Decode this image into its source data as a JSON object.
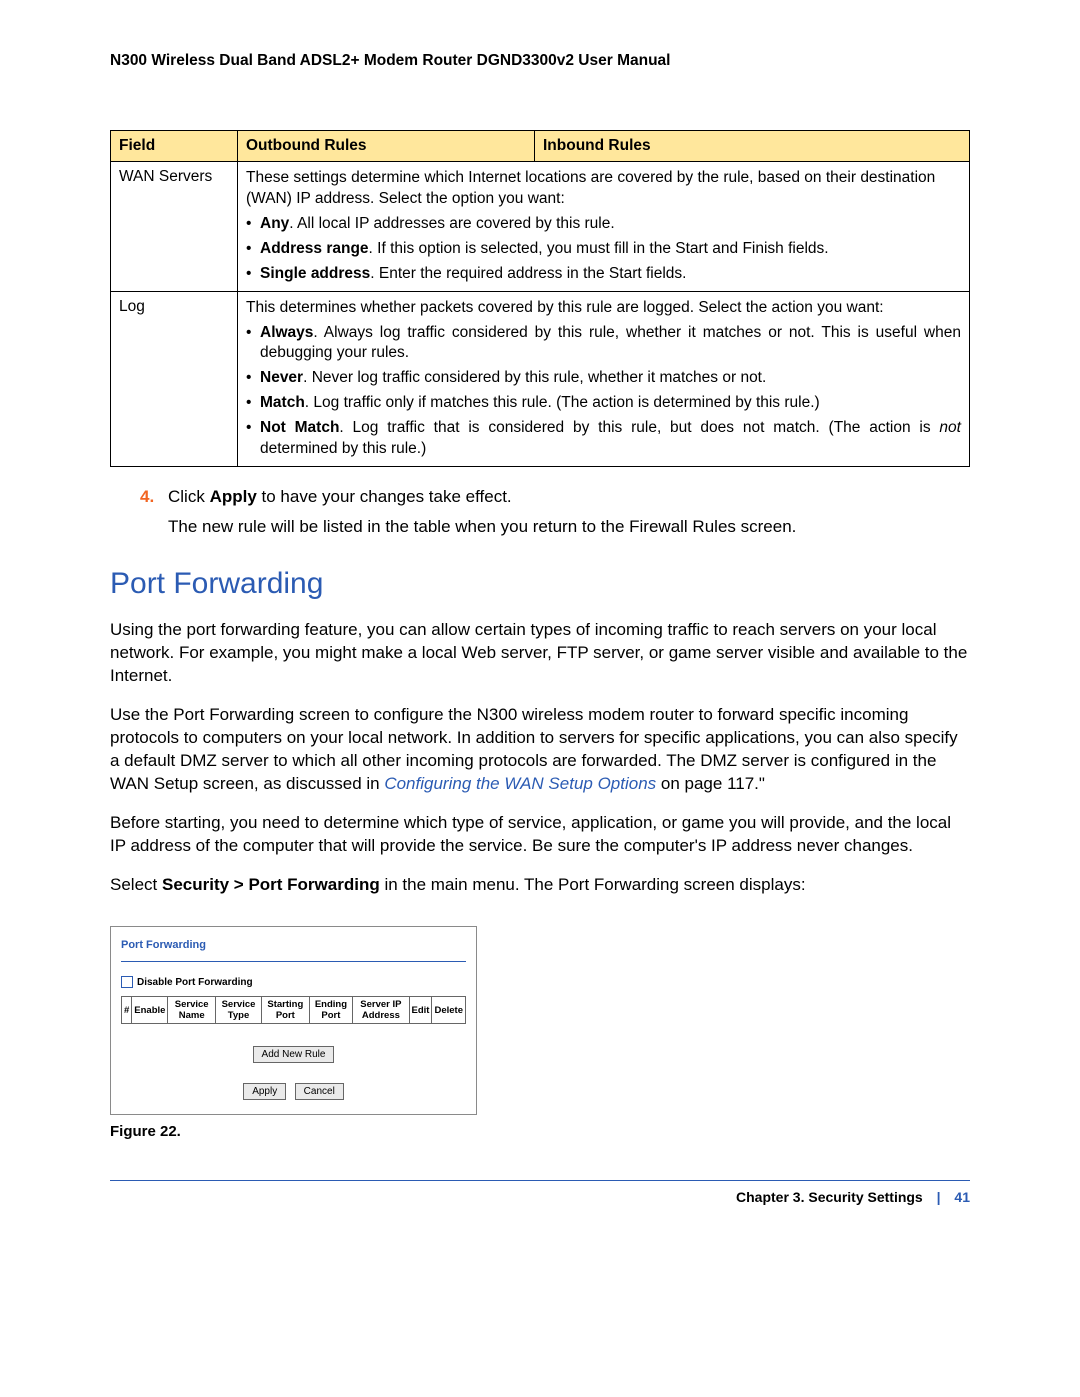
{
  "doc_title": "N300 Wireless Dual Band ADSL2+ Modem Router DGND3300v2 User Manual",
  "table": {
    "headers": {
      "field": "Field",
      "outbound": "Outbound Rules",
      "inbound": "Inbound Rules"
    },
    "rows": [
      {
        "field": "WAN Servers",
        "intro": "These settings determine which Internet locations are covered by the rule, based on their destination (WAN) IP address. Select the option you want:",
        "bullets": [
          {
            "b": "Any",
            "t": ". All local IP addresses are covered by this rule."
          },
          {
            "b": "Address range",
            "t": ". If this option is selected, you must fill in the Start and Finish fields."
          },
          {
            "b": "Single address",
            "t": ". Enter the required address in the Start fields."
          }
        ]
      },
      {
        "field": "Log",
        "intro": "This determines whether packets covered by this rule are logged. Select the action you want:",
        "bullets": [
          {
            "b": "Always",
            "t": ". Always log traffic considered by this rule, whether it matches or not. This is useful when debugging your rules."
          },
          {
            "b": "Never",
            "t": ". Never log traffic considered by this rule, whether it matches or not."
          },
          {
            "b": "Match",
            "t": ". Log traffic only if matches this rule. (The action is determined by this rule.)"
          },
          {
            "b": "Not Match",
            "t": ". Log traffic that is considered by this rule, but does not match. (The action is ",
            "i": "not",
            "t2": " determined by this rule.)"
          }
        ]
      }
    ]
  },
  "step": {
    "num": "4.",
    "text_pre": "Click ",
    "text_b": "Apply",
    "text_post": " to have your changes take effect.",
    "follow": "The new rule will be listed in the table when you return to the Firewall Rules screen."
  },
  "section_heading": "Port Forwarding",
  "para1": "Using the port forwarding feature, you can allow certain types of incoming traffic to reach servers on your local network. For example, you might make a local Web server, FTP server, or game server visible and available to the Internet.",
  "para2_pre": "Use the Port Forwarding screen to configure the N300 wireless modem router to forward specific incoming protocols to computers on your local network. In addition to servers for specific applications, you can also specify a default DMZ server to which all other incoming protocols are forwarded. The DMZ server is configured in the WAN Setup screen, as discussed in ",
  "para2_link": "Configuring the WAN Setup Options",
  "para2_post": " on page 117.\"",
  "para3": "Before starting, you need to determine which type of service, application, or game you will provide, and the local IP address of the computer that will provide the service. Be sure the computer's IP address never changes.",
  "para4_pre": "Select ",
  "para4_b": "Security > Port Forwarding",
  "para4_post": " in the main menu. The Port Forwarding screen displays:",
  "screenshot": {
    "title": "Port Forwarding",
    "disable_label": "Disable Port Forwarding",
    "cols": [
      "#",
      "Enable",
      "Service Name",
      "Service Type",
      "Starting Port",
      "Ending Port",
      "Server IP Address",
      "Edit",
      "Delete"
    ],
    "btn_add": "Add New Rule",
    "btn_apply": "Apply",
    "btn_cancel": "Cancel"
  },
  "figure_caption": "Figure 22. ",
  "footer": {
    "chapter": "Chapter 3.  Security Settings",
    "page": "41"
  }
}
